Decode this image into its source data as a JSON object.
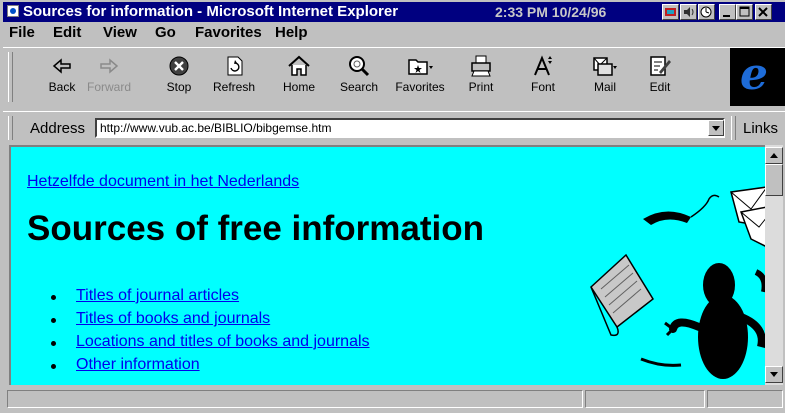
{
  "window": {
    "title": "Sources for information - Microsoft Internet Explorer",
    "clock": "2:33 PM  10/24/96"
  },
  "menu": [
    "File",
    "Edit",
    "View",
    "Go",
    "Favorites",
    "Help"
  ],
  "toolbar": {
    "buttons": [
      {
        "label": "Back",
        "icon": "back-arrow-icon",
        "enabled": true
      },
      {
        "label": "Forward",
        "icon": "forward-arrow-icon",
        "enabled": false
      },
      {
        "label": "Stop",
        "icon": "stop-icon",
        "enabled": true
      },
      {
        "label": "Refresh",
        "icon": "refresh-icon",
        "enabled": true
      },
      {
        "label": "Home",
        "icon": "home-icon",
        "enabled": true
      },
      {
        "label": "Search",
        "icon": "search-icon",
        "enabled": true
      },
      {
        "label": "Favorites",
        "icon": "favorites-icon",
        "enabled": true
      },
      {
        "label": "Print",
        "icon": "print-icon",
        "enabled": true
      },
      {
        "label": "Font",
        "icon": "font-icon",
        "enabled": true
      },
      {
        "label": "Mail",
        "icon": "mail-icon",
        "enabled": true
      },
      {
        "label": "Edit",
        "icon": "edit-icon",
        "enabled": true
      }
    ]
  },
  "address": {
    "label": "Address",
    "url": "http://www.vub.ac.be/BIBLIO/bibgemse.htm",
    "links_label": "Links"
  },
  "page": {
    "dutch_link": "Hetzelfde document in het Nederlands",
    "heading": "Sources of free information",
    "links": [
      "Titles of journal articles",
      "Titles of books and journals",
      "Locations and titles of books and journals",
      "Other information"
    ],
    "background_color": "#00ffff",
    "link_color": "#0000ee"
  },
  "colors": {
    "titlebar": "#000080",
    "chrome": "#c0c0c0"
  }
}
